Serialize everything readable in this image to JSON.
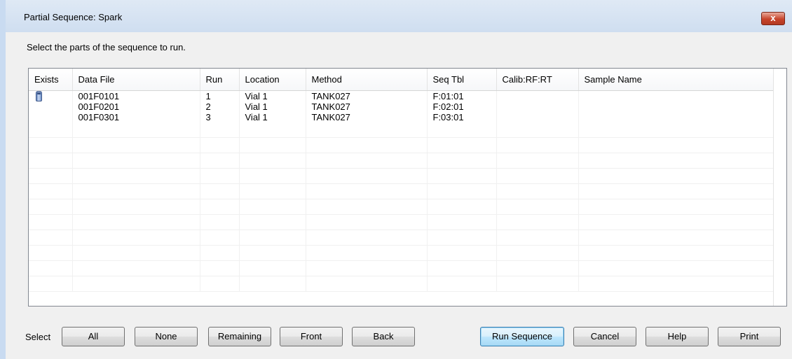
{
  "window": {
    "title": "Partial Sequence: Spark",
    "close_label": "x"
  },
  "instructions": "Select the parts of the sequence to run.",
  "table": {
    "columns": [
      "Exists",
      "Data File",
      "Run",
      "Location",
      "Method",
      "Seq Tbl",
      "Calib:RF:RT",
      "Sample Name"
    ],
    "rows": [
      {
        "exists": true,
        "data_file": "001F0101",
        "run": "1",
        "location": "Vial 1",
        "method": "TANK027",
        "seq_tbl": "F:01:01",
        "calib": "",
        "sample_name": ""
      },
      {
        "exists": false,
        "data_file": "001F0201",
        "run": "2",
        "location": "Vial 1",
        "method": "TANK027",
        "seq_tbl": "F:02:01",
        "calib": "",
        "sample_name": ""
      },
      {
        "exists": false,
        "data_file": "001F0301",
        "run": "3",
        "location": "Vial 1",
        "method": "TANK027",
        "seq_tbl": "F:03:01",
        "calib": "",
        "sample_name": ""
      }
    ],
    "exists_icon": "vial-icon"
  },
  "select": {
    "label": "Select",
    "all": "All",
    "none": "None",
    "remaining": "Remaining",
    "front": "Front",
    "back": "Back"
  },
  "actions": {
    "run_sequence": "Run Sequence",
    "cancel": "Cancel",
    "help": "Help",
    "print": "Print"
  },
  "colors": {
    "close_button": "#c7442b",
    "titlebar": "#dfe9f5",
    "default_button_border": "#3c7fb1"
  }
}
